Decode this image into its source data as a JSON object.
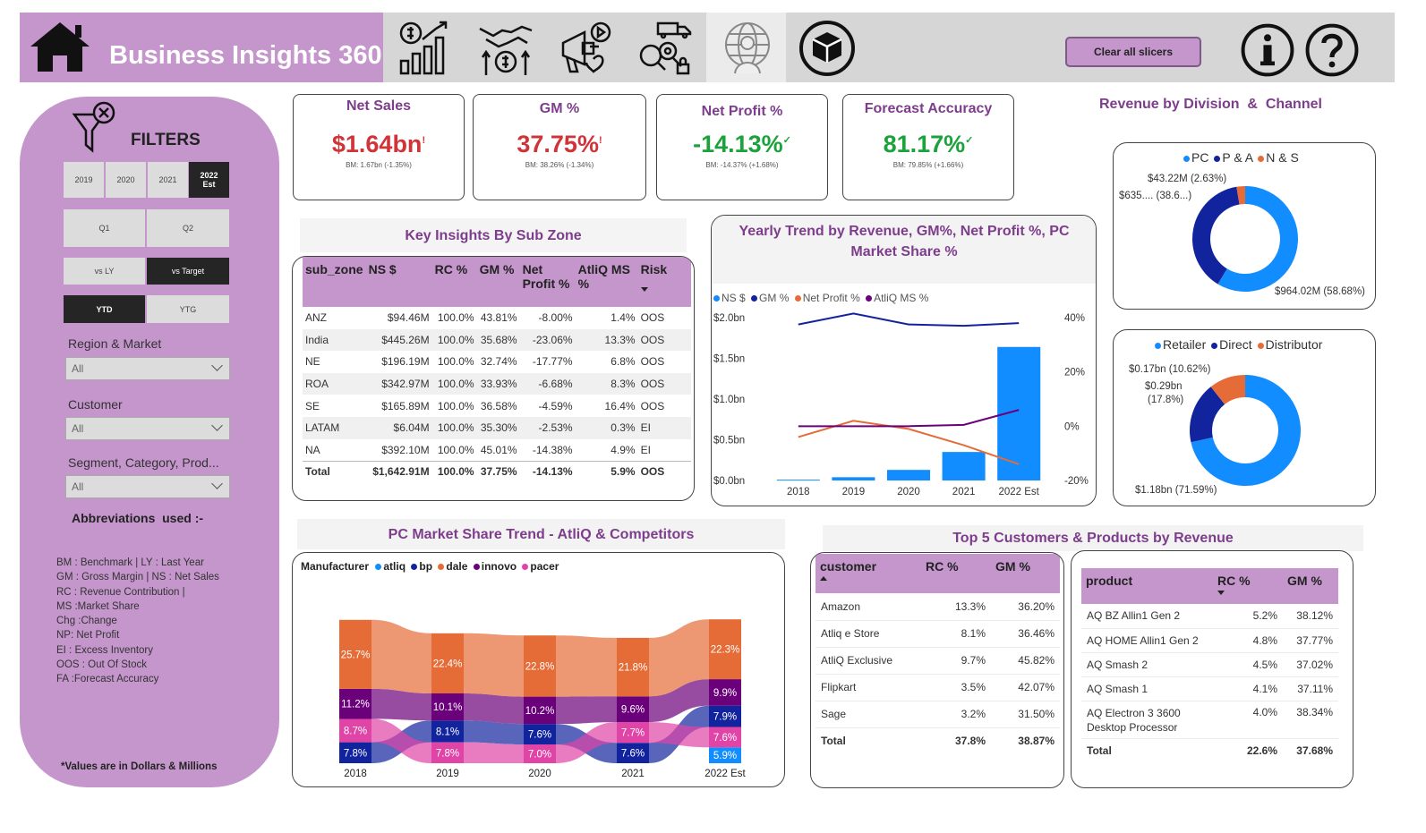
{
  "app": {
    "title": "Business Insights 360",
    "clear_button": "Clear all slicers"
  },
  "nav": {
    "icons": [
      "home-icon",
      "finance-view-icon",
      "sales-view-icon",
      "marketing-view-icon",
      "supply-chain-view-icon",
      "executive-view-icon",
      "info-icon",
      "help-icon"
    ]
  },
  "filters": {
    "title": "FILTERS",
    "years": [
      "2019",
      "2020",
      "2021",
      "2022\nEst"
    ],
    "quarters": [
      "Q1",
      "Q2"
    ],
    "compare": [
      "vs LY",
      "vs Target"
    ],
    "period": [
      "YTD",
      "YTG"
    ],
    "region_label": "Region & Market",
    "region_value": "All",
    "customer_label": "Customer",
    "customer_value": "All",
    "segment_label": "Segment, Category, Prod...",
    "segment_value": "All",
    "abbr_title": "Abbreviations  used :-",
    "abbr_lines": [
      "BM : Benchmark | LY : Last Year",
      "GM : Gross Margin  | NS : Net Sales",
      "RC  : Revenue Contribution |",
      "MS :Market Share",
      "Chg :Change",
      "NP: Net Profit",
      "EI : Excess Inventory",
      "OOS : Out Of Stock",
      "FA :Forecast Accuracy"
    ],
    "values_note": "*Values are in Dollars & Millions"
  },
  "kpis": {
    "net_sales": {
      "title": "Net Sales",
      "value": "$1.64bn",
      "mark": "!",
      "sub": "BM: 1.67bn (-1.35%)",
      "color": "#d13438"
    },
    "gm": {
      "title": "GM %",
      "value": "37.75%",
      "mark": "!",
      "sub": "BM: 38.26% (-1.34%)",
      "color": "#d13438"
    },
    "net_profit": {
      "title": "Net Profit %",
      "value": "-14.13%",
      "mark": "✓",
      "sub": "BM: -14.37% (+1.68%)",
      "color": "#1aa33a"
    },
    "forecast": {
      "title": "Forecast Accuracy",
      "value": "81.17%",
      "mark": "✓",
      "sub": "BM: 79.85% (+1.66%)",
      "color": "#1aa33a"
    }
  },
  "subzone": {
    "title": "Key Insights By Sub Zone",
    "headers": [
      "sub_zone",
      "NS $",
      "RC %",
      "GM %",
      "Net Profit %",
      "AtliQ MS %",
      "Risk"
    ],
    "rows": [
      [
        "ANZ",
        "$94.46M",
        "100.0%",
        "43.81%",
        "-8.00%",
        "1.4%",
        "OOS"
      ],
      [
        "India",
        "$445.26M",
        "100.0%",
        "35.68%",
        "-23.06%",
        "13.3%",
        "OOS"
      ],
      [
        "NE",
        "$196.19M",
        "100.0%",
        "32.74%",
        "-17.77%",
        "6.8%",
        "OOS"
      ],
      [
        "ROA",
        "$342.97M",
        "100.0%",
        "33.93%",
        "-6.68%",
        "8.3%",
        "OOS"
      ],
      [
        "SE",
        "$165.89M",
        "100.0%",
        "36.58%",
        "-4.59%",
        "16.4%",
        "OOS"
      ],
      [
        "LATAM",
        "$6.04M",
        "100.0%",
        "35.30%",
        "-2.53%",
        "0.3%",
        "EI"
      ],
      [
        "NA",
        "$392.10M",
        "100.0%",
        "45.01%",
        "-14.38%",
        "4.9%",
        "EI"
      ]
    ],
    "total": [
      "Total",
      "$1,642.91M",
      "100.0%",
      "37.75%",
      "-14.13%",
      "5.9%",
      "OOS"
    ]
  },
  "trend": {
    "title": "Yearly Trend by Revenue, GM%, Net Profit %, PC Market Share %",
    "legend": [
      {
        "name": "NS $",
        "color": "#118dff"
      },
      {
        "name": "GM %",
        "color": "#12239e"
      },
      {
        "name": "Net Profit %",
        "color": "#e66c37"
      },
      {
        "name": "AtliQ MS %",
        "color": "#6b007b"
      }
    ]
  },
  "division": {
    "title": "Revenue by Division  &  Channel",
    "legend": [
      {
        "name": "PC",
        "color": "#118dff"
      },
      {
        "name": "P & A",
        "color": "#12239e"
      },
      {
        "name": "N & S",
        "color": "#e66c37"
      }
    ],
    "labels": [
      "$43.22M (2.63%)",
      "$635.... (38.6...)",
      "$964.02M (58.68%)"
    ]
  },
  "channel": {
    "legend": [
      {
        "name": "Retailer",
        "color": "#118dff"
      },
      {
        "name": "Direct",
        "color": "#12239e"
      },
      {
        "name": "Distributor",
        "color": "#e66c37"
      }
    ],
    "labels": [
      "$0.17bn (10.62%)",
      "$0.29bn",
      "(17.8%)",
      "$1.18bn (71.59%)"
    ]
  },
  "marketshare": {
    "title": "PC Market Share Trend - AtliQ & Competitors",
    "legend_title": "Manufacturer",
    "legend": [
      {
        "name": "atliq",
        "color": "#118dff"
      },
      {
        "name": "bp",
        "color": "#12239e"
      },
      {
        "name": "dale",
        "color": "#e66c37"
      },
      {
        "name": "innovo",
        "color": "#6b007b"
      },
      {
        "name": "pacer",
        "color": "#e044a7"
      }
    ]
  },
  "top5": {
    "title": "Top 5 Customers &  Products by Revenue",
    "customer_headers": [
      "customer",
      "RC %",
      "GM %"
    ],
    "customers": [
      [
        "Amazon",
        "13.3%",
        "36.20%"
      ],
      [
        "Atliq e Store",
        "8.1%",
        "36.46%"
      ],
      [
        "AtliQ Exclusive",
        "9.7%",
        "45.82%"
      ],
      [
        "Flipkart",
        "3.5%",
        "42.07%"
      ],
      [
        "Sage",
        "3.2%",
        "31.50%"
      ]
    ],
    "customer_total": [
      "Total",
      "37.8%",
      "38.87%"
    ],
    "product_headers": [
      "product",
      "RC %",
      "GM %"
    ],
    "products": [
      [
        "AQ BZ Allin1 Gen 2",
        "5.2%",
        "38.12%"
      ],
      [
        "AQ HOME Allin1 Gen 2",
        "4.8%",
        "37.77%"
      ],
      [
        "AQ Smash 2",
        "4.5%",
        "37.02%"
      ],
      [
        "AQ Smash 1",
        "4.1%",
        "37.11%"
      ],
      [
        "AQ Electron 3 3600 Desktop Processor",
        "4.0%",
        "38.34%"
      ]
    ],
    "product_total": [
      "Total",
      "22.6%",
      "37.68%"
    ]
  },
  "chart_data": [
    {
      "type": "bar",
      "title": "Yearly Trend by Revenue, GM%, Net Profit %, PC Market Share %",
      "categories": [
        "2018",
        "2019",
        "2020",
        "2021",
        "2022 Est"
      ],
      "y_ticks_left": [
        "$0.0bn",
        "$0.5bn",
        "$1.0bn",
        "$1.5bn",
        "$2.0bn"
      ],
      "y_ticks_right": [
        "-20%",
        "0%",
        "20%",
        "40%"
      ],
      "ylim_left": [
        0,
        2.0
      ],
      "ylim_right": [
        -20,
        40
      ],
      "series": [
        {
          "name": "NS $",
          "kind": "bar",
          "axis": "left",
          "values": [
            0.01,
            0.04,
            0.13,
            0.35,
            1.64
          ]
        },
        {
          "name": "GM %",
          "kind": "line",
          "axis": "right",
          "values": [
            37.5,
            41.5,
            37.5,
            37,
            38
          ]
        },
        {
          "name": "Net Profit %",
          "kind": "line",
          "axis": "right",
          "values": [
            -4,
            2,
            -1,
            -7,
            -14
          ]
        },
        {
          "name": "AtliQ MS %",
          "kind": "line",
          "axis": "right",
          "values": [
            0,
            0,
            0,
            0.5,
            6
          ]
        }
      ]
    },
    {
      "type": "pie",
      "title": "Revenue by Division",
      "categories": [
        "PC",
        "P & A",
        "N & S"
      ],
      "values": [
        58.68,
        38.69,
        2.63
      ]
    },
    {
      "type": "pie",
      "title": "Revenue by Channel",
      "categories": [
        "Retailer",
        "Direct",
        "Distributor"
      ],
      "values": [
        71.59,
        17.8,
        10.62
      ]
    },
    {
      "type": "area",
      "title": "PC Market Share Trend - AtliQ & Competitors",
      "categories": [
        "2018",
        "2019",
        "2020",
        "2021",
        "2022 Est"
      ],
      "series": [
        {
          "name": "atliq",
          "values": [
            0,
            0,
            0,
            0,
            5.9
          ]
        },
        {
          "name": "bp",
          "values": [
            7.8,
            8.1,
            7.6,
            7.6,
            7.9
          ]
        },
        {
          "name": "pacer",
          "values": [
            8.7,
            7.8,
            7.0,
            7.7,
            7.6
          ]
        },
        {
          "name": "innovo",
          "values": [
            11.2,
            10.1,
            10.2,
            9.6,
            9.9
          ]
        },
        {
          "name": "dale",
          "values": [
            25.7,
            22.4,
            22.8,
            21.8,
            22.3
          ]
        }
      ]
    }
  ]
}
